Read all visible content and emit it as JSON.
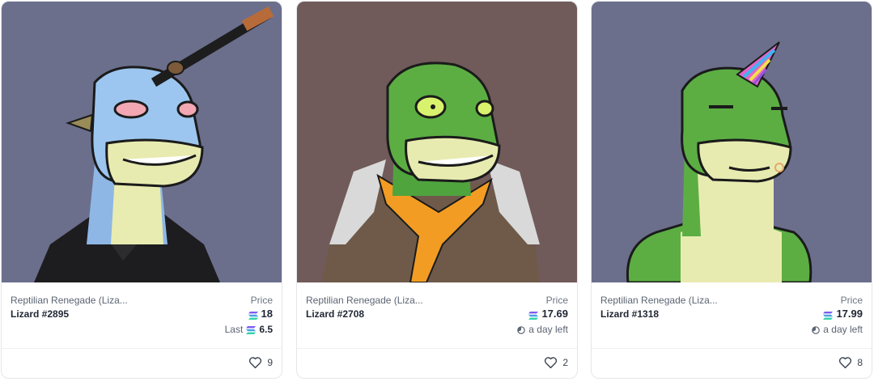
{
  "icons": {
    "currency": "solana-icon",
    "timer": "clock-icon",
    "favorite": "heart-icon"
  },
  "colors": {
    "card_border": "#e4e6ea",
    "text_primary": "#1f2633",
    "text_secondary": "#5b6472"
  },
  "cards": [
    {
      "art_background": "#6b6f8c",
      "collection": "Reptilian Renegade (Liza...",
      "name": "Lizard #2895",
      "price_label": "Price",
      "price": "18",
      "sub_label": "Last",
      "sub_value": "6.5",
      "likes": "9"
    },
    {
      "art_background": "#705a5a",
      "collection": "Reptilian Renegade (Liza...",
      "name": "Lizard #2708",
      "price_label": "Price",
      "price": "17.69",
      "sub_text": "a day left",
      "likes": "2"
    },
    {
      "art_background": "#6b6f8c",
      "collection": "Reptilian Renegade (Liza...",
      "name": "Lizard #1318",
      "price_label": "Price",
      "price": "17.99",
      "sub_text": "a day left",
      "likes": "8"
    }
  ]
}
